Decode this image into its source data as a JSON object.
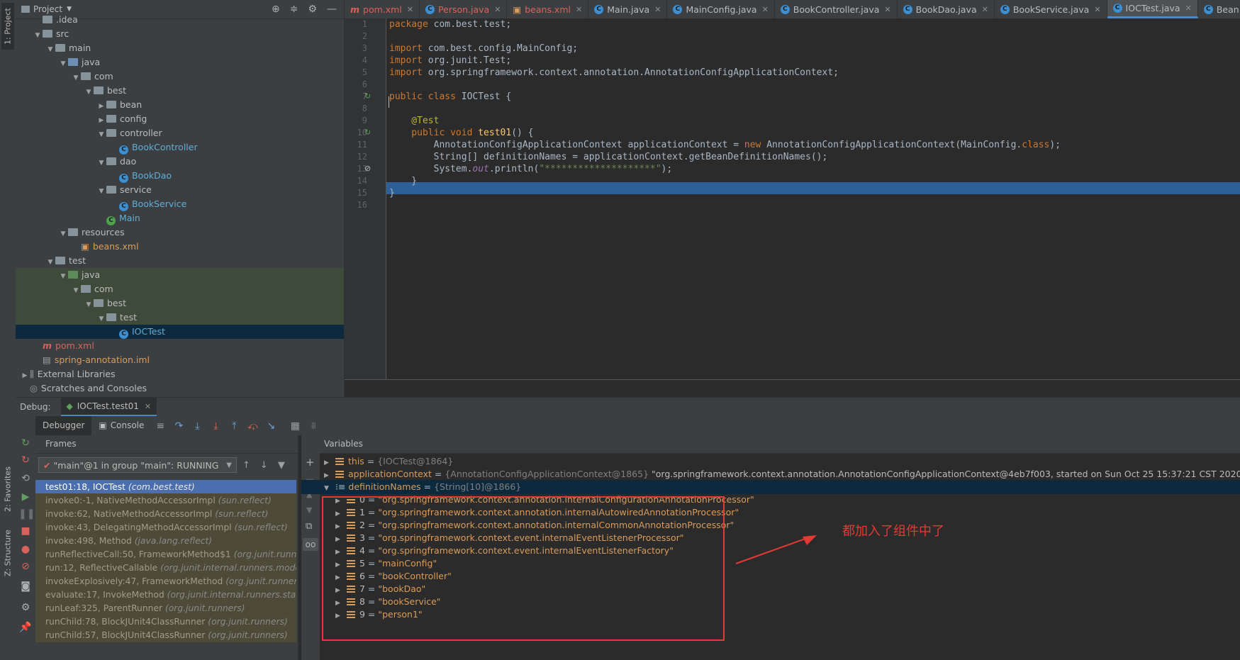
{
  "side_tabs": [
    "1: Project",
    "2: Favorites",
    "Z: Structure"
  ],
  "project": {
    "title": "Project",
    "tree": [
      {
        "label": ".idea",
        "depth": 1,
        "kind": "folder",
        "arrow": "",
        "color": ""
      },
      {
        "label": "src",
        "depth": 1,
        "kind": "folder",
        "arrow": "▼",
        "color": ""
      },
      {
        "label": "main",
        "depth": 2,
        "kind": "folder",
        "arrow": "▼",
        "color": ""
      },
      {
        "label": "java",
        "depth": 3,
        "kind": "folder-blue",
        "arrow": "▼",
        "color": ""
      },
      {
        "label": "com",
        "depth": 4,
        "kind": "folder",
        "arrow": "▼",
        "color": ""
      },
      {
        "label": "best",
        "depth": 5,
        "kind": "folder",
        "arrow": "▼",
        "color": ""
      },
      {
        "label": "bean",
        "depth": 6,
        "kind": "folder",
        "arrow": "▶",
        "color": ""
      },
      {
        "label": "config",
        "depth": 6,
        "kind": "folder",
        "arrow": "▶",
        "color": ""
      },
      {
        "label": "controller",
        "depth": 6,
        "kind": "folder",
        "arrow": "▼",
        "color": ""
      },
      {
        "label": "BookController",
        "depth": 7,
        "kind": "class",
        "arrow": "",
        "color": "blue"
      },
      {
        "label": "dao",
        "depth": 6,
        "kind": "folder",
        "arrow": "▼",
        "color": ""
      },
      {
        "label": "BookDao",
        "depth": 7,
        "kind": "class",
        "arrow": "",
        "color": "blue"
      },
      {
        "label": "service",
        "depth": 6,
        "kind": "folder",
        "arrow": "▼",
        "color": ""
      },
      {
        "label": "BookService",
        "depth": 7,
        "kind": "class",
        "arrow": "",
        "color": "blue"
      },
      {
        "label": "Main",
        "depth": 6,
        "kind": "class-green",
        "arrow": "",
        "color": "blue"
      },
      {
        "label": "resources",
        "depth": 3,
        "kind": "folder-res",
        "arrow": "▼",
        "color": ""
      },
      {
        "label": "beans.xml",
        "depth": 4,
        "kind": "xml",
        "arrow": "",
        "color": "orange"
      },
      {
        "label": "test",
        "depth": 2,
        "kind": "folder",
        "arrow": "▼",
        "color": ""
      },
      {
        "label": "java",
        "depth": 3,
        "kind": "folder-green",
        "arrow": "▼",
        "color": "",
        "hl": "green"
      },
      {
        "label": "com",
        "depth": 4,
        "kind": "folder",
        "arrow": "▼",
        "color": "",
        "hl": "green"
      },
      {
        "label": "best",
        "depth": 5,
        "kind": "folder",
        "arrow": "▼",
        "color": "",
        "hl": "green"
      },
      {
        "label": "test",
        "depth": 6,
        "kind": "folder",
        "arrow": "▼",
        "color": "",
        "hl": "green"
      },
      {
        "label": "IOCTest",
        "depth": 7,
        "kind": "class",
        "arrow": "",
        "color": "blue",
        "hl": "sel"
      },
      {
        "label": "pom.xml",
        "depth": 1,
        "kind": "maven",
        "arrow": "",
        "color": "red"
      },
      {
        "label": "spring-annotation.iml",
        "depth": 1,
        "kind": "file",
        "arrow": "",
        "color": "orange"
      },
      {
        "label": "External Libraries",
        "depth": 0,
        "kind": "lib",
        "arrow": "▶",
        "color": ""
      },
      {
        "label": "Scratches and Consoles",
        "depth": 0,
        "kind": "scratch",
        "arrow": "",
        "color": ""
      }
    ]
  },
  "editor_tabs": [
    {
      "label": "pom.xml",
      "icon": "m",
      "color": "red"
    },
    {
      "label": "Person.java",
      "icon": "c",
      "color": "red"
    },
    {
      "label": "beans.xml",
      "icon": "xml",
      "color": "red"
    },
    {
      "label": "Main.java",
      "icon": "c",
      "color": ""
    },
    {
      "label": "MainConfig.java",
      "icon": "c",
      "color": ""
    },
    {
      "label": "BookController.java",
      "icon": "c",
      "color": ""
    },
    {
      "label": "BookDao.java",
      "icon": "c",
      "color": ""
    },
    {
      "label": "BookService.java",
      "icon": "c",
      "color": ""
    },
    {
      "label": "IOCTest.java",
      "icon": "c",
      "color": "",
      "active": true
    },
    {
      "label": "Bean.class",
      "icon": "c",
      "color": ""
    }
  ],
  "code": {
    "line_numbers": [
      "1",
      "2",
      "3",
      "4",
      "5",
      "6",
      "7",
      "8",
      "9",
      "10",
      "11",
      "12",
      "13",
      "14",
      "15",
      "16"
    ],
    "lines": {
      "l1_kw": "package",
      "l1_rest": " com.best.test;",
      "l3_kw": "import",
      "l3_rest": " com.best.config.MainConfig;",
      "l4_kw": "import",
      "l4_rest": " org.junit.Test;",
      "l5_kw": "import",
      "l5_rest": " org.springframework.context.annotation.AnnotationConfigApplicationContext;",
      "l7_kw": "public class",
      "l7_rest": " IOCTest {",
      "l9_ann": "    @Test",
      "l10_kw": "    public void",
      "l10_fn": " test01",
      "l10_rest": "() {",
      "l11_a": "        AnnotationConfigApplicationContext applicationContext = ",
      "l11_kw": "new",
      "l11_b": " AnnotationConfigApplicationContext(MainConfig.",
      "l11_kw2": "class",
      "l11_c": ");",
      "l12_a": "        String[] definitionNames = applicationContext.getBeanDefinitionNames();",
      "l13_a": "        System.",
      "l13_out": "out",
      "l13_b": ".println(",
      "l13_str": "\"********************\"",
      "l13_c": ");",
      "l14": "    }",
      "l15": "}"
    }
  },
  "debug": {
    "label": "Debug:",
    "session": "IOCTest.test01",
    "tab_debugger": "Debugger",
    "tab_console": "Console",
    "frames_title": "Frames",
    "variables_title": "Variables",
    "thread": "\"main\"@1 in group \"main\": RUNNING",
    "frames": [
      {
        "method": "test01:18, IOCTest",
        "pkg": "(com.best.test)",
        "style": "sel"
      },
      {
        "method": "invoke0:-1, NativeMethodAccessorImpl",
        "pkg": "(sun.reflect)",
        "style": "lib"
      },
      {
        "method": "invoke:62, NativeMethodAccessorImpl",
        "pkg": "(sun.reflect)",
        "style": "lib"
      },
      {
        "method": "invoke:43, DelegatingMethodAccessorImpl",
        "pkg": "(sun.reflect)",
        "style": "lib"
      },
      {
        "method": "invoke:498, Method",
        "pkg": "(java.lang.reflect)",
        "style": "lib"
      },
      {
        "method": "runReflectiveCall:50, FrameworkMethod$1",
        "pkg": "(org.junit.runners",
        "style": "lib"
      },
      {
        "method": "run:12, ReflectiveCallable",
        "pkg": "(org.junit.internal.runners.model)",
        "style": "lib"
      },
      {
        "method": "invokeExplosively:47, FrameworkMethod",
        "pkg": "(org.junit.runners.m",
        "style": "lib"
      },
      {
        "method": "evaluate:17, InvokeMethod",
        "pkg": "(org.junit.internal.runners.stateme",
        "style": "lib"
      },
      {
        "method": "runLeaf:325, ParentRunner",
        "pkg": "(org.junit.runners)",
        "style": "lib"
      },
      {
        "method": "runChild:78, BlockJUnit4ClassRunner",
        "pkg": "(org.junit.runners)",
        "style": "lib"
      },
      {
        "method": "runChild:57, BlockJUnit4ClassRunner",
        "pkg": "(org.junit.runners)",
        "style": "lib"
      }
    ],
    "variables": {
      "this": {
        "name": "this",
        "ref": "{IOCTest@1864}"
      },
      "ctx": {
        "name": "applicationContext",
        "ref": "{AnnotationConfigApplicationContext@1865}",
        "value": "\"org.springframework.context.annotation.AnnotationConfigApplicationContext@4eb7f003, started on Sun Oct 25 15:37:21 CST 2020\""
      },
      "names": {
        "name": "definitionNames",
        "ref": "{String[10]@1866}"
      },
      "items": [
        {
          "idx": "0",
          "value": "\"org.springframework.context.annotation.internalConfigurationAnnotationProcessor\""
        },
        {
          "idx": "1",
          "value": "\"org.springframework.context.annotation.internalAutowiredAnnotationProcessor\""
        },
        {
          "idx": "2",
          "value": "\"org.springframework.context.annotation.internalCommonAnnotationProcessor\""
        },
        {
          "idx": "3",
          "value": "\"org.springframework.context.event.internalEventListenerProcessor\""
        },
        {
          "idx": "4",
          "value": "\"org.springframework.context.event.internalEventListenerFactory\""
        },
        {
          "idx": "5",
          "value": "\"mainConfig\""
        },
        {
          "idx": "6",
          "value": "\"bookController\""
        },
        {
          "idx": "7",
          "value": "\"bookDao\""
        },
        {
          "idx": "8",
          "value": "\"bookService\""
        },
        {
          "idx": "9",
          "value": "\"person1\""
        }
      ]
    },
    "annotation_note": "都加入了组件中了"
  },
  "colors": {
    "accent": "#4a88c7",
    "annotation": "#e53935",
    "selection": "#4b6eaf"
  }
}
